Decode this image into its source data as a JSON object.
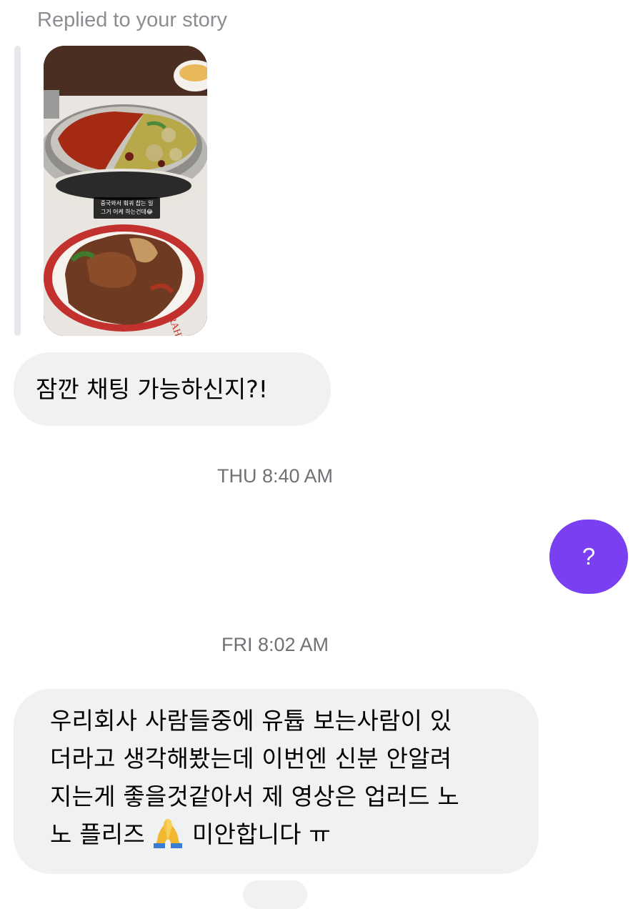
{
  "thread": {
    "reply_label": "Replied to your story",
    "story": {
      "caption_line1": "중국와서 훠궈 찹는 일",
      "caption_line2": "그거 어케 하는건데😂"
    },
    "messages": [
      {
        "text": "잠깐 채팅 가능하신지?!"
      },
      {
        "timestamp": "THU 8:40 AM"
      },
      {
        "text": "?"
      },
      {
        "timestamp": "FRI 8:02 AM"
      },
      {
        "lines": [
          "우리회사 사람들중에 유튭 보는사람이 있",
          "더라고 생각해봤는데 이번엔 신분 안알려",
          "지는게 좋을것같아서 제 영상은 업러드 노",
          "노 플리즈",
          "미안합니다 ㅠ"
        ]
      }
    ]
  },
  "colors": {
    "outgoing_bubble": "#7b3ff2",
    "incoming_bubble": "#f0f1f3",
    "timestamp_text": "#6e7175"
  },
  "icons": [
    "folded-hands-emoji"
  ]
}
